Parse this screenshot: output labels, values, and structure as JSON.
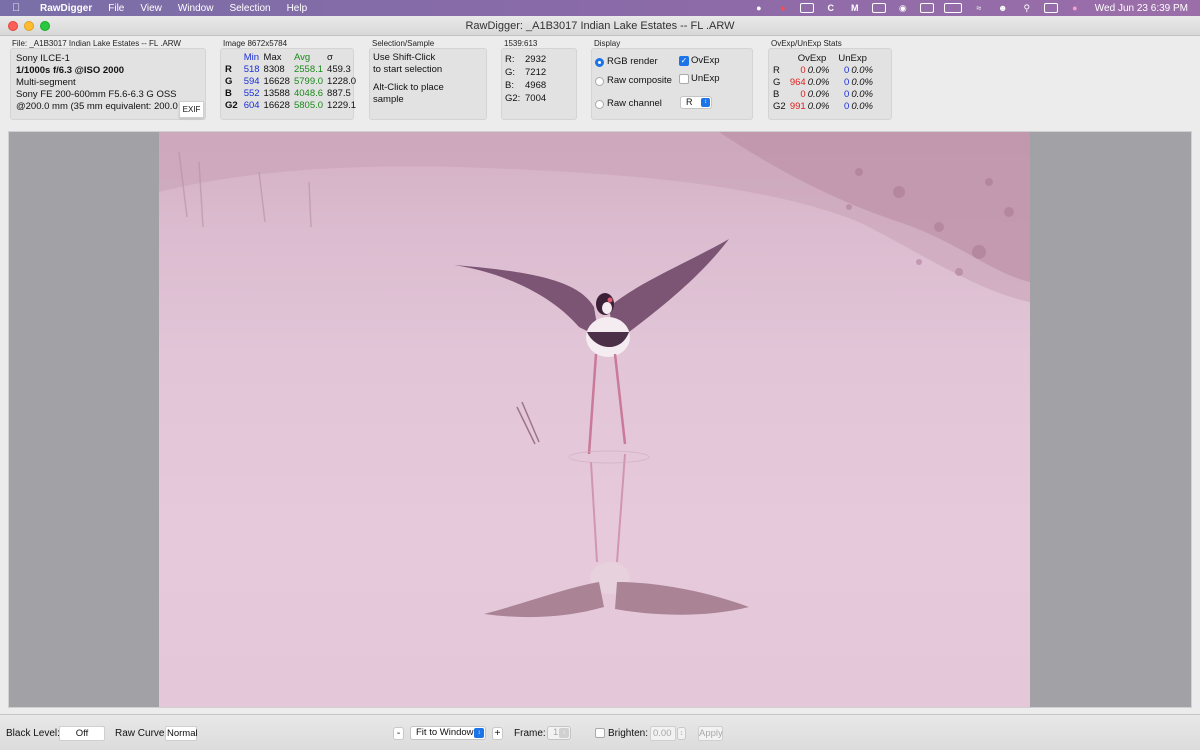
{
  "menubar": {
    "app": "RawDigger",
    "items": [
      "File",
      "View",
      "Window",
      "Selection",
      "Help"
    ],
    "clock": "Wed Jun 23  6:39 PM"
  },
  "window": {
    "title": "RawDigger: _A1B3017 Indian Lake Estates -- FL .ARW"
  },
  "file_panel": {
    "label": "File: _A1B3017 Indian Lake Estates -- FL .ARW",
    "camera": "Sony ILCE-1",
    "exposure": "1/1000s f/6.3 @ISO 2000",
    "mode": "Multi-segment",
    "lens": "Sony FE 200-600mm F5.6-6.3 G OSS",
    "focal": "@200.0 mm (35 mm equivalent: 200.0 mm)",
    "exif_button": "EXIF"
  },
  "image_panel": {
    "label": "Image 8672x5784",
    "headers": [
      "",
      "Min",
      "Max",
      "Avg",
      "σ"
    ],
    "rows": [
      {
        "ch": "R",
        "min": "518",
        "max": "8308",
        "avg": "2558.1",
        "sigma": "459.3"
      },
      {
        "ch": "G",
        "min": "594",
        "max": "16628",
        "avg": "5799.0",
        "sigma": "1228.0"
      },
      {
        "ch": "B",
        "min": "552",
        "max": "13588",
        "avg": "4048.6",
        "sigma": "887.5"
      },
      {
        "ch": "G2",
        "min": "604",
        "max": "16628",
        "avg": "5805.0",
        "sigma": "1229.1"
      }
    ]
  },
  "selection_panel": {
    "label": "Selection/Sample",
    "line1": "Use Shift-Click",
    "line2": "to start selection",
    "line3": "Alt-Click to place",
    "line4": "sample"
  },
  "coord_panel": {
    "label": "1539:613",
    "rows": [
      {
        "k": "R:",
        "v": "2932"
      },
      {
        "k": "G:",
        "v": "7212"
      },
      {
        "k": "B:",
        "v": "4968"
      },
      {
        "k": "G2:",
        "v": "7004"
      }
    ]
  },
  "display_panel": {
    "label": "Display",
    "rgb_render": "RGB render",
    "raw_composite": "Raw composite",
    "raw_channel": "Raw channel",
    "ovexp": "OvExp",
    "unexp": "UnExp",
    "channel": "R"
  },
  "ovexp_panel": {
    "label": "OvExp/UnExp Stats",
    "head_ov": "OvExp",
    "head_un": "UnExp",
    "rows": [
      {
        "ch": "R",
        "ov": "0",
        "ovp": "0.0%",
        "un": "0",
        "unp": "0.0%"
      },
      {
        "ch": "G",
        "ov": "964",
        "ovp": "0.0%",
        "un": "0",
        "unp": "0.0%"
      },
      {
        "ch": "B",
        "ov": "0",
        "ovp": "0.0%",
        "un": "0",
        "unp": "0.0%"
      },
      {
        "ch": "G2",
        "ov": "991",
        "ovp": "0.0%",
        "un": "0",
        "unp": "0.0%"
      }
    ]
  },
  "bottombar": {
    "black_level_label": "Black Level:",
    "black_level_value": "Off",
    "raw_curve_label": "Raw Curve:",
    "raw_curve_value": "Normal",
    "zoom_out": "-",
    "zoom_value": "Fit to Window",
    "zoom_in": "+",
    "frame_label": "Frame:",
    "frame_value": "1",
    "brighten_label": "Brighten:",
    "brighten_value": "0.00",
    "apply": "Apply"
  },
  "colors": {
    "accent": "#1b74e8",
    "min_blue": "#1a2fd6",
    "avg_green": "#1a8a1a",
    "overexposed_red": "#e0201c"
  }
}
